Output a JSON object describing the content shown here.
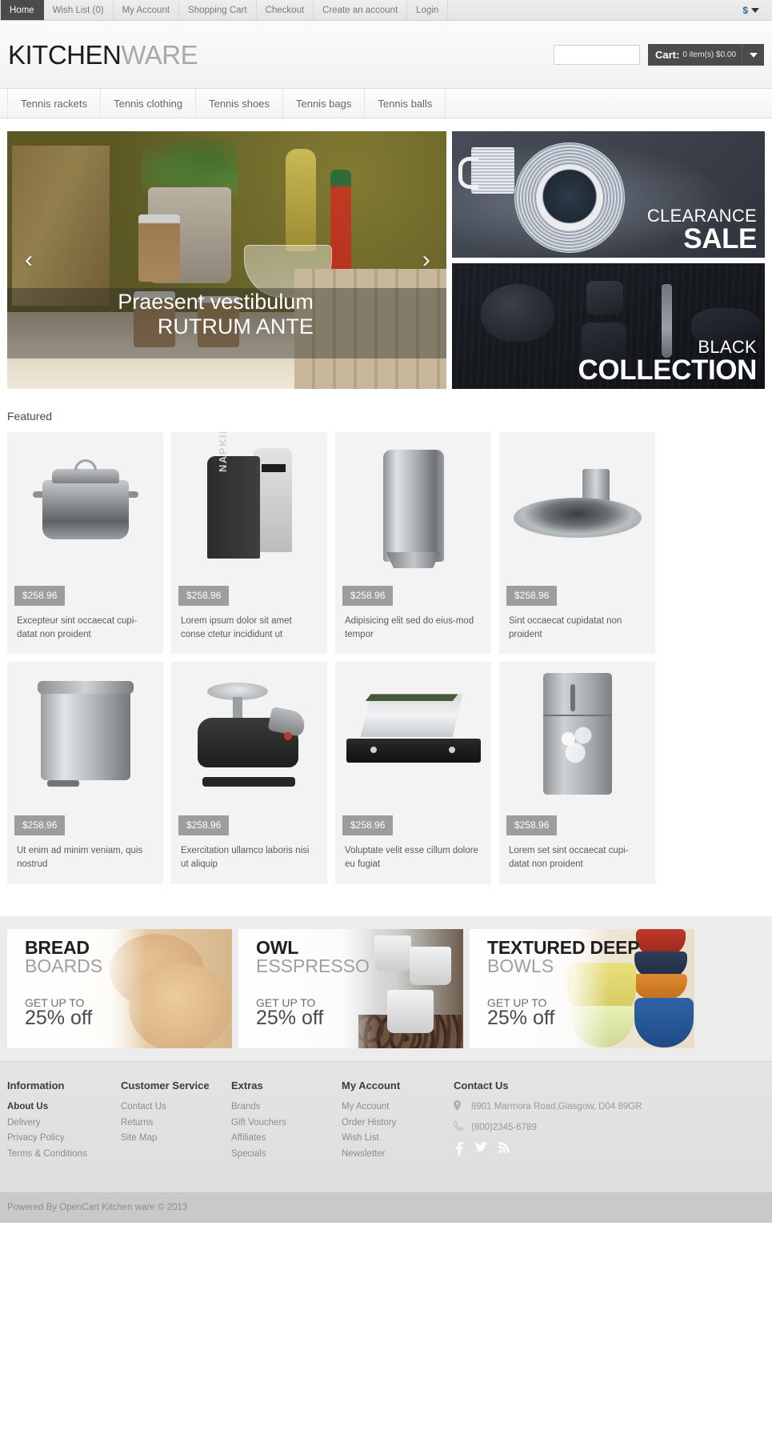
{
  "topbar": {
    "links": [
      {
        "label": "Home",
        "active": true
      },
      {
        "label": "Wish List (0)",
        "active": false
      },
      {
        "label": "My Account",
        "active": false
      },
      {
        "label": "Shopping Cart",
        "active": false
      },
      {
        "label": "Checkout",
        "active": false
      },
      {
        "label": "Create an account",
        "active": false
      },
      {
        "label": "Login",
        "active": false
      }
    ],
    "currency_symbol": "$"
  },
  "header": {
    "logo_part1": "KITCHEN",
    "logo_part2": "WARE",
    "search_placeholder": "",
    "search_value": "",
    "cart_label": "Cart:",
    "cart_value": "0 item(s) $0.00"
  },
  "catnav": {
    "items": [
      {
        "label": "Tennis rackets"
      },
      {
        "label": "Tennis clothing"
      },
      {
        "label": "Tennis shoes"
      },
      {
        "label": "Tennis bags"
      },
      {
        "label": "Tennis balls"
      }
    ]
  },
  "slider": {
    "caption_line1": "Praesent vestibulum",
    "caption_line2": "RUTRUM ANTE",
    "prev": "‹",
    "next": "›"
  },
  "side_banners": [
    {
      "line1": "CLEARANCE",
      "line2": "SALE",
      "name": "clearance-banner"
    },
    {
      "line1": "BLACK",
      "line2": "COLLECTION",
      "name": "black-collection-banner"
    }
  ],
  "featured": {
    "title": "Featured",
    "products": [
      {
        "price": "$258.96",
        "name": "Excepteur sint occaecat cupi-datat non proident",
        "shape": "pot"
      },
      {
        "price": "$258.96",
        "name": "Lorem ipsum dolor sit amet conse ctetur incididunt ut",
        "shape": "napkin",
        "badge": "NAPKIN"
      },
      {
        "price": "$258.96",
        "name": "Adipisicing elit sed do eius-mod tempor",
        "shape": "cylinder"
      },
      {
        "price": "$258.96",
        "name": "Sint occaecat cupidatat non proident",
        "shape": "hood"
      },
      {
        "price": "$258.96",
        "name": "Ut enim ad minim veniam, quis nostrud",
        "shape": "bin"
      },
      {
        "price": "$258.96",
        "name": "Exercitation ullamco laboris nisi ut aliquip",
        "shape": "grinder"
      },
      {
        "price": "$258.96",
        "name": "Voluptate velit esse cillum dolore eu fugiat",
        "shape": "range"
      },
      {
        "price": "$258.96",
        "name": "Lorem set sint occaecat cupi-datat non proident",
        "shape": "fridge"
      }
    ]
  },
  "promos": [
    {
      "t1": "BREAD",
      "t2": "BOARDS",
      "t3": "GET UP TO",
      "t4": "25% off"
    },
    {
      "t1": "OWL",
      "t2": "ESSPRESSO",
      "t3": "GET UP TO",
      "t4": "25% off"
    },
    {
      "t1": "TEXTURED DEEP",
      "t2": "BOWLS",
      "t3": "GET UP TO",
      "t4": "25% off"
    }
  ],
  "footer": {
    "columns": [
      {
        "title": "Information",
        "links": [
          {
            "label": "About Us",
            "strong": true
          },
          {
            "label": "Delivery",
            "strong": false
          },
          {
            "label": "Privacy Policy",
            "strong": false
          },
          {
            "label": "Terms & Conditions",
            "strong": false
          }
        ]
      },
      {
        "title": "Customer Service",
        "links": [
          {
            "label": "Contact Us",
            "strong": false
          },
          {
            "label": "Returns",
            "strong": false
          },
          {
            "label": "Site Map",
            "strong": false
          }
        ]
      },
      {
        "title": "Extras",
        "links": [
          {
            "label": "Brands",
            "strong": false
          },
          {
            "label": "Gift Vouchers",
            "strong": false
          },
          {
            "label": "Affiliates",
            "strong": false
          },
          {
            "label": "Specials",
            "strong": false
          }
        ]
      },
      {
        "title": "My Account",
        "links": [
          {
            "label": "My Account",
            "strong": false
          },
          {
            "label": "Order History",
            "strong": false
          },
          {
            "label": "Wish List",
            "strong": false
          },
          {
            "label": "Newsletter",
            "strong": false
          }
        ]
      }
    ],
    "contact": {
      "title": "Contact Us",
      "address": "8901 Marmora Road,Glasgow, D04 89GR",
      "phone": "(800)2345-6789",
      "social": [
        "facebook-icon",
        "twitter-icon",
        "rss-icon"
      ]
    },
    "copyright": "Powered By OpenCart Kitchen ware © 2013"
  },
  "colors": {
    "accent_dark": "#4b4b4b",
    "price_badge": "#9d9d9d",
    "currency_blue": "#2e6da4",
    "card_bg": "#f3f3f3"
  }
}
